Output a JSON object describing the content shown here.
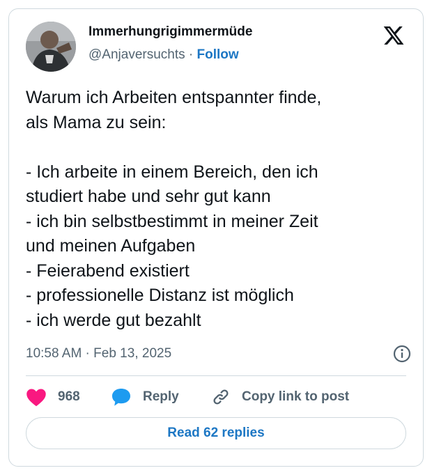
{
  "author": {
    "display_name": "Immerhungrigimmermüde",
    "handle": "@Anjaversuchts",
    "separator": "·",
    "follow_label": "Follow"
  },
  "brand": {
    "logo_icon": "x-logo-icon",
    "color": "#0f1419"
  },
  "tweet": {
    "text": "Warum ich Arbeiten entspannter finde,\nals Mama zu sein:\n\n- Ich arbeite in einem Bereich, den ich\nstudiert habe und sehr gut kann\n- ich bin selbstbestimmt in meiner Zeit\nund meinen Aufgaben\n- Feierabend existiert\n- professionelle Distanz ist möglich\n- ich werde gut bezahlt",
    "timestamp": "10:58 AM · Feb 13, 2025",
    "info_icon": "info-icon"
  },
  "actions": {
    "like_count": "968",
    "like_icon": "heart-icon",
    "like_color": "#f91880",
    "reply_label": "Reply",
    "reply_icon": "speech-bubble-icon",
    "reply_color": "#1d9bf0",
    "copy_label": "Copy link to post",
    "copy_icon": "link-icon"
  },
  "footer": {
    "read_replies_label": "Read 62 replies"
  },
  "colors": {
    "accent": "#1d77c4",
    "muted": "#536471",
    "border": "#cfd9de"
  }
}
